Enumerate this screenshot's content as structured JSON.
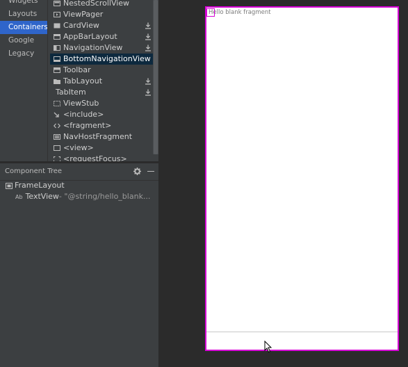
{
  "palette": {
    "categories": [
      {
        "label": "Widgets"
      },
      {
        "label": "Layouts"
      },
      {
        "label": "Containers",
        "selected": true
      },
      {
        "label": "Google"
      },
      {
        "label": "Legacy"
      }
    ],
    "items": [
      {
        "label": "NestedScrollView",
        "icon": "scroll-icon",
        "download": false
      },
      {
        "label": "ViewPager",
        "icon": "viewpager-icon",
        "download": false
      },
      {
        "label": "CardView",
        "icon": "card-icon",
        "download": true
      },
      {
        "label": "AppBarLayout",
        "icon": "appbar-icon",
        "download": true
      },
      {
        "label": "NavigationView",
        "icon": "navigation-icon",
        "download": true
      },
      {
        "label": "BottomNavigationView",
        "icon": "bottom-nav-icon",
        "download": false,
        "selected": true
      },
      {
        "label": "Toolbar",
        "icon": "toolbar-icon",
        "download": false
      },
      {
        "label": "TabLayout",
        "icon": "folder-icon",
        "download": true
      },
      {
        "label": "TabItem",
        "icon": "",
        "download": true
      },
      {
        "label": "ViewStub",
        "icon": "dashed-box-icon",
        "download": false
      },
      {
        "label": "<include>",
        "icon": "arrow-in-icon",
        "download": false
      },
      {
        "label": "<fragment>",
        "icon": "code-brackets-icon",
        "download": false
      },
      {
        "label": "NavHostFragment",
        "icon": "nav-host-icon",
        "download": false
      },
      {
        "label": "<view>",
        "icon": "box-icon",
        "download": false
      },
      {
        "label": "<requestFocus>",
        "icon": "focus-icon",
        "download": false
      }
    ]
  },
  "component_tree": {
    "title": "Component Tree",
    "root": {
      "label": "FrameLayout"
    },
    "child": {
      "prefix": "Ab",
      "label": "TextView",
      "value": "- \"@string/hello_blank..."
    }
  },
  "design": {
    "text": "Hello blank fragment",
    "accent": "#d600d6"
  },
  "colors": {
    "panel": "#3c3f41",
    "background": "#2b2b2b",
    "selected_category": "#2f65ca",
    "selected_item": "#0d293e"
  }
}
